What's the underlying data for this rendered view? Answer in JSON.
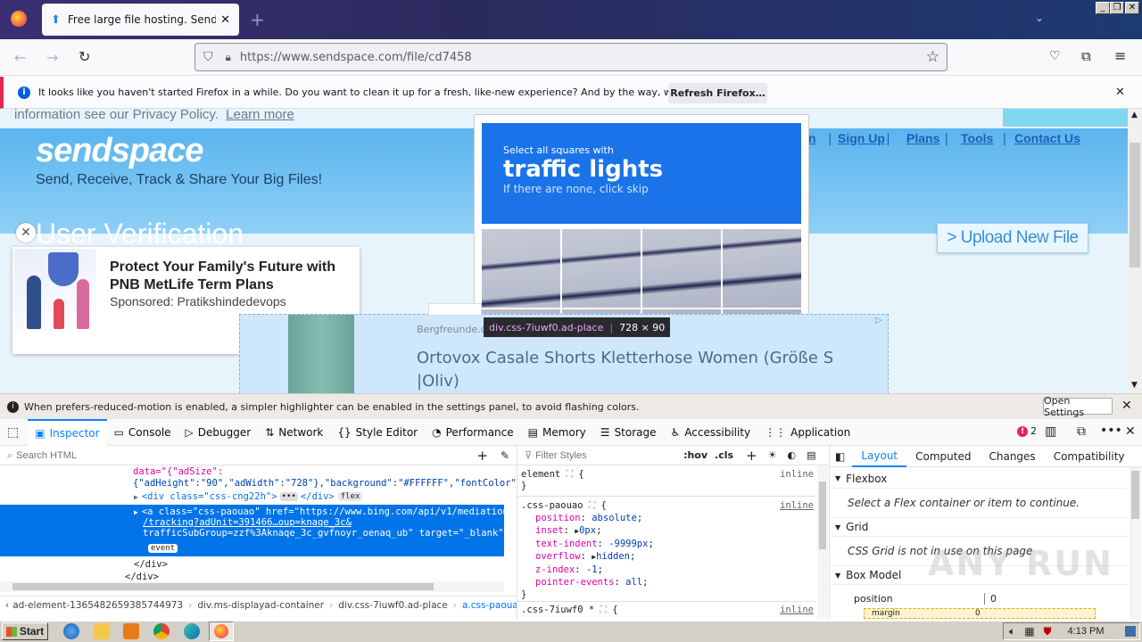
{
  "browser": {
    "tab_title": "Free large file hosting. Send big file",
    "url": "https://www.sendspace.com/file/cd7458",
    "notice_text": "It looks like you haven't started Firefox in a while. Do you want to clean it up for a fresh, like-new experience? And by the way, welcome back!",
    "notice_button": "Refresh Firefox…"
  },
  "page": {
    "privacy_text": "information see our Privacy Policy.",
    "learn_more": "Learn more",
    "logo": "sendspace",
    "tagline": "Send, Receive, Track & Share Your Big Files!",
    "nav": [
      "n",
      "Sign Up",
      "Plans",
      "Tools",
      "Contact Us"
    ],
    "heading": "User Verification",
    "upload_button": "> Upload New File",
    "captcha": {
      "line1": "Select all squares with",
      "line2": "traffic lights",
      "line3": "If there are none, click skip"
    },
    "ad": {
      "title": "Protect Your Family's Future with PNB MetLife Term Plans",
      "sponsor": "Sponsored: Pratikshindedevops"
    },
    "banner": {
      "source": "Bergfreunde.d",
      "title": "Ortovox Casale Shorts Kletterhose Women (Größe S |Oliv)"
    },
    "tooltip": {
      "selector": "div.css-7iuwf0.ad-place",
      "size": "728 × 90"
    }
  },
  "devtools": {
    "motion_notice": "When prefers-reduced-motion is enabled, a simpler highlighter can be enabled in the settings panel, to avoid flashing colors.",
    "open_settings": "Open Settings",
    "tabs": [
      "Inspector",
      "Console",
      "Debugger",
      "Network",
      "Style Editor",
      "Performance",
      "Memory",
      "Storage",
      "Accessibility",
      "Application"
    ],
    "error_count": "2",
    "search_html_placeholder": "Search HTML",
    "filter_styles_placeholder": "Filter Styles",
    "hov": ":hov",
    "cls": ".cls",
    "html_lines": {
      "l1": "data=\"{\"adSize\":",
      "l2": "{\"adHeight\":\"90\",\"adWidth\":\"728\"},\"background\":\"#FFFFFF\",\"fontColor\":",
      "l3_tag": "<div class=\"css-cng22h\">",
      "l3_end": "</div>",
      "l3_badge": "flex",
      "sel1": "<a class=\"css-paouao\" href=\"https://www.bing.com/api/v1/mediation",
      "sel2": "/tracking?adUnit=391466…oup=knaqe_3c&",
      "sel3": "trafficSubGroup=zzf%3Aknaqe_3c_gvfnoyr_oenaq_ub\" target=\"_blank\">",
      "sel_badge": "event",
      "l5": "</div>",
      "l6": "</div>"
    },
    "breadcrumbs": [
      "ad-element-1365482659385744973",
      "div.ms-displayad-container",
      "div.css-7iuwf0.ad-place",
      "a.css-paouao"
    ],
    "css": {
      "element_sel": "element",
      "inline": "inline",
      "rule_sel": ".css-paouao",
      "props": [
        {
          "name": "position",
          "value": "absolute"
        },
        {
          "name": "inset",
          "value": "0px"
        },
        {
          "name": "text-indent",
          "value": "-9999px"
        },
        {
          "name": "overflow",
          "value": "hidden"
        },
        {
          "name": "z-index",
          "value": "-1"
        },
        {
          "name": "pointer-events",
          "value": "all"
        }
      ],
      "next_sel": ".css-7iuwf0 *"
    },
    "layout_tabs": [
      "Layout",
      "Computed",
      "Changes",
      "Compatibility"
    ],
    "flexbox_title": "Flexbox",
    "flexbox_msg": "Select a Flex container or item to continue.",
    "grid_title": "Grid",
    "grid_msg": "CSS Grid is not in use on this page",
    "boxmodel_title": "Box Model",
    "position_label": "position",
    "position_value": "0",
    "margin_label": "margin",
    "margin_value": "0"
  },
  "taskbar": {
    "start": "Start",
    "time": "4:13 PM"
  },
  "watermark": "ANY RUN"
}
